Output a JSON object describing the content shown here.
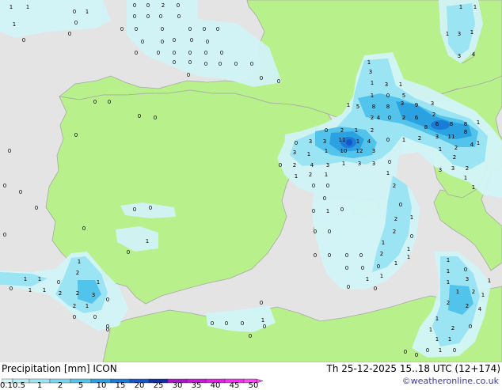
{
  "footer": {
    "title": "Precipitation [mm]  ICON",
    "datetime": "Th 25-12-2025 15..18 UTC (12+174)",
    "credit": "©weatheronline.co.uk"
  },
  "legend": {
    "ticks": [
      "0.1",
      "0.5",
      "1",
      "2",
      "5",
      "10",
      "15",
      "20",
      "25",
      "30",
      "35",
      "40",
      "45",
      "50"
    ],
    "colors": [
      "#d2f4f8",
      "#b5ecf6",
      "#9be4f4",
      "#7ad6f0",
      "#52c4ec",
      "#2aa2e2",
      "#1a7cd8",
      "#1456c8",
      "#0e2ea4",
      "#a818c8",
      "#c81ad6",
      "#e020e0",
      "#f030ee",
      "#f848f2"
    ]
  },
  "map_colors": {
    "sea": "#e4e4e4",
    "land": "#b8f08c",
    "coast": "#a8a8a8"
  },
  "rain_numbers": [
    [
      "1",
      14,
      6
    ],
    [
      "1",
      35,
      6
    ],
    [
      "0",
      94,
      12
    ],
    [
      "1",
      110,
      12
    ],
    [
      "0",
      170,
      4
    ],
    [
      "0",
      187,
      4
    ],
    [
      "2",
      206,
      4
    ],
    [
      "0",
      225,
      4
    ],
    [
      "1",
      18,
      28
    ],
    [
      "0",
      96,
      26
    ],
    [
      "0",
      170,
      18
    ],
    [
      "0",
      187,
      18
    ],
    [
      "0",
      203,
      18
    ],
    [
      "0",
      226,
      18
    ],
    [
      "0",
      88,
      40
    ],
    [
      "0",
      30,
      48
    ],
    [
      "0",
      154,
      34
    ],
    [
      "0",
      172,
      34
    ],
    [
      "0",
      205,
      34
    ],
    [
      "0",
      240,
      34
    ],
    [
      "0",
      258,
      34
    ],
    [
      "0",
      275,
      34
    ],
    [
      "0",
      180,
      50
    ],
    [
      "0",
      205,
      50
    ],
    [
      "0",
      220,
      48
    ],
    [
      "0",
      242,
      48
    ],
    [
      "0",
      262,
      50
    ],
    [
      "0",
      172,
      64
    ],
    [
      "0",
      200,
      64
    ],
    [
      "0",
      220,
      64
    ],
    [
      "0",
      240,
      64
    ],
    [
      "0",
      260,
      64
    ],
    [
      "0",
      280,
      64
    ],
    [
      "0",
      220,
      76
    ],
    [
      "0",
      240,
      76
    ],
    [
      "0",
      260,
      78
    ],
    [
      "0",
      278,
      78
    ],
    [
      "0",
      298,
      78
    ],
    [
      "0",
      318,
      78
    ],
    [
      "0",
      238,
      92
    ],
    [
      "0",
      330,
      96
    ],
    [
      "0",
      352,
      100
    ],
    [
      "1",
      582,
      6
    ],
    [
      "1",
      600,
      6
    ],
    [
      "1",
      565,
      40
    ],
    [
      "3",
      580,
      40
    ],
    [
      "1",
      596,
      38
    ],
    [
      "3",
      580,
      68
    ],
    [
      "4",
      598,
      66
    ],
    [
      "3",
      468,
      88
    ],
    [
      "1",
      466,
      76
    ],
    [
      "1",
      470,
      102
    ],
    [
      "3",
      488,
      104
    ],
    [
      "1",
      506,
      104
    ],
    [
      "1",
      470,
      118
    ],
    [
      "0",
      490,
      118
    ],
    [
      "5",
      510,
      118
    ],
    [
      "1",
      440,
      130
    ],
    [
      "5",
      452,
      132
    ],
    [
      "8",
      472,
      132
    ],
    [
      "8",
      490,
      132
    ],
    [
      "3",
      508,
      128
    ],
    [
      "9",
      526,
      130
    ],
    [
      "3",
      546,
      128
    ],
    [
      "2",
      470,
      146
    ],
    [
      "4",
      478,
      146
    ],
    [
      "0",
      492,
      146
    ],
    [
      "2",
      510,
      146
    ],
    [
      "6",
      526,
      146
    ],
    [
      "2",
      548,
      142
    ],
    [
      "8",
      538,
      158
    ],
    [
      "6",
      552,
      154
    ],
    [
      "8",
      570,
      154
    ],
    [
      "8",
      588,
      154
    ],
    [
      "1",
      604,
      152
    ],
    [
      "0",
      412,
      162
    ],
    [
      "2",
      432,
      162
    ],
    [
      "1",
      450,
      162
    ],
    [
      "2",
      470,
      162
    ],
    [
      "0",
      490,
      174
    ],
    [
      "1",
      510,
      174
    ],
    [
      "2",
      530,
      172
    ],
    [
      "3",
      552,
      170
    ],
    [
      "11",
      570,
      170
    ],
    [
      "8",
      588,
      164
    ],
    [
      "1",
      604,
      178
    ],
    [
      "0",
      374,
      178
    ],
    [
      "3",
      392,
      176
    ],
    [
      "3",
      410,
      176
    ],
    [
      "11",
      432,
      174
    ],
    [
      "1",
      452,
      176
    ],
    [
      "4",
      466,
      176
    ],
    [
      "10",
      434,
      188
    ],
    [
      "12",
      454,
      188
    ],
    [
      "3",
      472,
      188
    ],
    [
      "1",
      390,
      192
    ],
    [
      "3",
      372,
      190
    ],
    [
      "1",
      412,
      188
    ],
    [
      "1",
      556,
      186
    ],
    [
      "2",
      576,
      184
    ],
    [
      "4",
      596,
      180
    ],
    [
      "0",
      354,
      206
    ],
    [
      "2",
      372,
      206
    ],
    [
      "4",
      394,
      206
    ],
    [
      "3",
      414,
      206
    ],
    [
      "1",
      434,
      204
    ],
    [
      "3",
      454,
      204
    ],
    [
      "3",
      472,
      204
    ],
    [
      "0",
      492,
      202
    ],
    [
      "3",
      556,
      212
    ],
    [
      "2",
      574,
      196
    ],
    [
      "2",
      590,
      210
    ],
    [
      "1",
      374,
      220
    ],
    [
      "2",
      392,
      218
    ],
    [
      "1",
      412,
      218
    ],
    [
      "1",
      490,
      216
    ],
    [
      "3",
      572,
      210
    ],
    [
      "1",
      588,
      222
    ],
    [
      "1",
      598,
      234
    ],
    [
      "0",
      396,
      232
    ],
    [
      "0",
      414,
      232
    ],
    [
      "2",
      498,
      232
    ],
    [
      "0",
      410,
      248
    ],
    [
      "1",
      414,
      264
    ],
    [
      "0",
      396,
      264
    ],
    [
      "0",
      432,
      262
    ],
    [
      "0",
      506,
      256
    ],
    [
      "2",
      500,
      274
    ],
    [
      "1",
      520,
      272
    ],
    [
      "0",
      416,
      290
    ],
    [
      "0",
      398,
      290
    ],
    [
      "2",
      498,
      290
    ],
    [
      "1",
      484,
      304
    ],
    [
      "0",
      520,
      296
    ],
    [
      "1",
      516,
      312
    ],
    [
      "0",
      398,
      320
    ],
    [
      "0",
      416,
      320
    ],
    [
      "2",
      482,
      318
    ],
    [
      "0",
      438,
      320
    ],
    [
      "0",
      456,
      320
    ],
    [
      "1",
      500,
      330
    ],
    [
      "1",
      516,
      322
    ],
    [
      "0",
      438,
      336
    ],
    [
      "0",
      458,
      336
    ],
    [
      "0",
      478,
      334
    ],
    [
      "1",
      464,
      350
    ],
    [
      "0",
      440,
      360
    ],
    [
      "1",
      482,
      346
    ],
    [
      "0",
      474,
      362
    ],
    [
      "1",
      100,
      328
    ],
    [
      "2",
      98,
      342
    ],
    [
      "1",
      32,
      350
    ],
    [
      "1",
      50,
      350
    ],
    [
      "0",
      74,
      354
    ],
    [
      "1",
      124,
      354
    ],
    [
      "0",
      14,
      362
    ],
    [
      "1",
      38,
      364
    ],
    [
      "1",
      56,
      364
    ],
    [
      "2",
      76,
      368
    ],
    [
      "2",
      98,
      368
    ],
    [
      "3",
      118,
      370
    ],
    [
      "1",
      110,
      384
    ],
    [
      "2",
      94,
      384
    ],
    [
      "0",
      136,
      376
    ],
    [
      "0",
      120,
      398
    ],
    [
      "0",
      94,
      398
    ],
    [
      "0",
      136,
      410
    ],
    [
      "0",
      136,
      414
    ],
    [
      "0",
      330,
      380
    ],
    [
      "0",
      268,
      406
    ],
    [
      "0",
      286,
      406
    ],
    [
      "0",
      306,
      406
    ],
    [
      "1",
      332,
      402
    ],
    [
      "0",
      334,
      410
    ],
    [
      "0",
      316,
      422
    ],
    [
      "0",
      170,
      262
    ],
    [
      "0",
      190,
      260
    ],
    [
      "0",
      106,
      286
    ],
    [
      "1",
      186,
      302
    ],
    [
      "0",
      162,
      316
    ],
    [
      "0",
      120,
      126
    ],
    [
      "0",
      138,
      126
    ],
    [
      "0",
      176,
      144
    ],
    [
      "0",
      196,
      146
    ],
    [
      "0",
      96,
      168
    ],
    [
      "0",
      12,
      188
    ],
    [
      "0",
      6,
      232
    ],
    [
      "0",
      26,
      240
    ],
    [
      "0",
      46,
      260
    ],
    [
      "0",
      6,
      294
    ],
    [
      "1",
      566,
      326
    ],
    [
      "1",
      566,
      340
    ],
    [
      "0",
      588,
      338
    ],
    [
      "3",
      590,
      350
    ],
    [
      "1",
      566,
      354
    ],
    [
      "1",
      578,
      366
    ],
    [
      "2",
      598,
      366
    ],
    [
      "1",
      610,
      370
    ],
    [
      "2",
      566,
      380
    ],
    [
      "2",
      590,
      384
    ],
    [
      "4",
      606,
      388
    ],
    [
      "1",
      552,
      400
    ],
    [
      "2",
      572,
      412
    ],
    [
      "0",
      594,
      410
    ],
    [
      "1",
      544,
      414
    ],
    [
      "1",
      552,
      426
    ],
    [
      "1",
      568,
      426
    ],
    [
      "0",
      540,
      440
    ],
    [
      "1",
      556,
      440
    ],
    [
      "0",
      574,
      440
    ],
    [
      "0",
      512,
      442
    ],
    [
      "0",
      526,
      446
    ],
    [
      "1",
      618,
      352
    ]
  ]
}
